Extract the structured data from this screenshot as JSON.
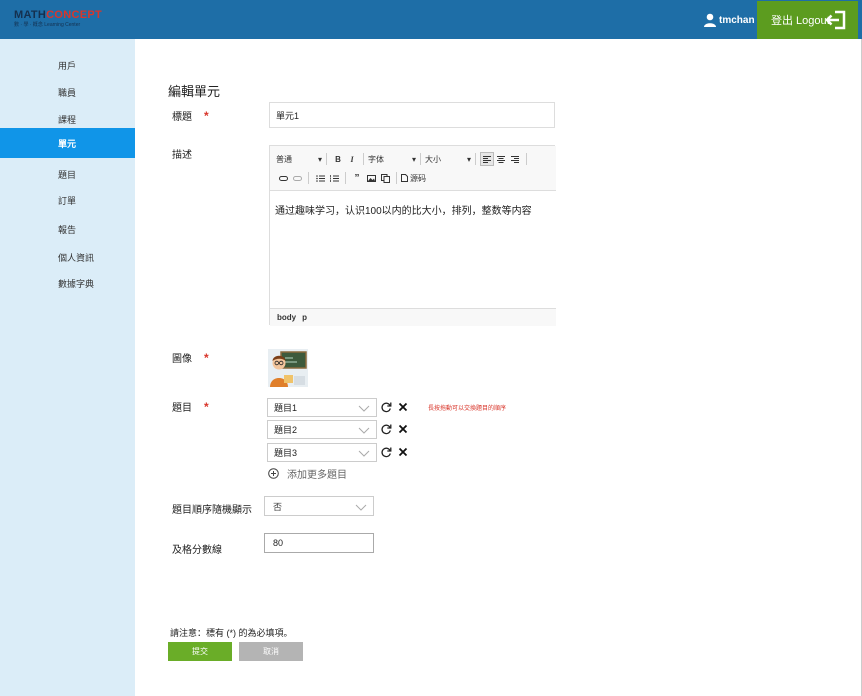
{
  "header": {
    "logo_main_1": "MATH",
    "logo_main_2": "CONCEPT",
    "logo_sub": "數 · 學 · 概念 Learning Center",
    "username": "tmchan",
    "logout_label": "登出 Logout",
    "bar_color": "#1e6ea7",
    "logout_color": "#5c9c1f"
  },
  "sidebar": {
    "active_color": "#1095e8",
    "items": [
      {
        "label": "用戶"
      },
      {
        "label": "職員"
      },
      {
        "label": "課程"
      },
      {
        "label": "單元"
      },
      {
        "label": "題目"
      },
      {
        "label": "訂單"
      },
      {
        "label": "報告"
      },
      {
        "label": "個人資訊"
      },
      {
        "label": "數據字典"
      }
    ]
  },
  "form": {
    "page_title": "編輯單元",
    "title_label": "標題",
    "title_value": "單元1",
    "description_label": "描述",
    "editor": {
      "format_select": "普通",
      "font_select": "字体",
      "size_select": "大小",
      "source_label": "源码",
      "content": "通过趣味学习，认识100以内的比大小，排列，整数等内容",
      "path_body": "body",
      "path_p": "p"
    },
    "image_label": "圖像",
    "questions_label": "題目",
    "questions": [
      "題目1",
      "題目2",
      "題目3"
    ],
    "drag_hint": "長按拖動可以交換題目的順序",
    "add_more_label": "添加更多題目",
    "random_order_label": "題目順序隨機顯示",
    "random_order_value": "否",
    "pass_score_label": "及格分數線",
    "pass_score_value": "80",
    "required_note": "請注意：標有 (*) 的為必填項。",
    "required_mark": "*",
    "submit_label": "提交",
    "cancel_label": "取消",
    "required_color": "#d9362b",
    "submit_color": "#6aad28"
  }
}
